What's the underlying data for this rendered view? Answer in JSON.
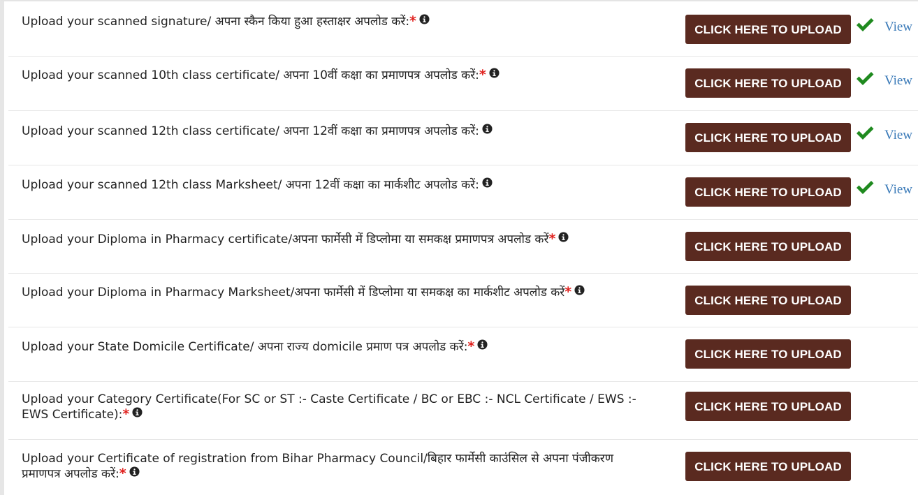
{
  "upload_rows": [
    {
      "label": "Upload your scanned signature/ अपना स्कैन किया हुआ हस्ताक्षर अपलोड करें:",
      "required": "*",
      "button": "CLICK HERE TO UPLOAD",
      "uploaded": true,
      "view_label": "View"
    },
    {
      "label": "Upload your scanned 10th class certificate/ अपना 10वीं कक्षा का प्रमाणपत्र अपलोड करें:",
      "required": "*",
      "button": "CLICK HERE TO UPLOAD",
      "uploaded": true,
      "view_label": "View"
    },
    {
      "label": "Upload your scanned 12th class certificate/ अपना 12वीं कक्षा का प्रमाणपत्र अपलोड करें:",
      "required": "",
      "button": "CLICK HERE TO UPLOAD",
      "uploaded": true,
      "view_label": "View"
    },
    {
      "label": "Upload your scanned 12th class Marksheet/ अपना 12वीं कक्षा का मार्कशीट अपलोड करें:",
      "required": "",
      "button": "CLICK HERE TO UPLOAD",
      "uploaded": true,
      "view_label": "View"
    },
    {
      "label": "Upload your Diploma in Pharmacy certificate/अपना फार्मेसी में डिप्लोमा या समकक्ष प्रमाणपत्र अपलोड करें",
      "required": "*",
      "button": "CLICK HERE TO UPLOAD",
      "uploaded": false
    },
    {
      "label": "Upload your Diploma in Pharmacy Marksheet/अपना फार्मेसी में डिप्लोमा या समकक्ष का मार्कशीट अपलोड करें",
      "required": "*",
      "button": "CLICK HERE TO UPLOAD",
      "uploaded": false
    },
    {
      "label": "Upload your State Domicile Certificate/ अपना राज्य domicile प्रमाण पत्र अपलोड करें:",
      "required": "*",
      "button": "CLICK HERE TO UPLOAD",
      "uploaded": false
    },
    {
      "label": "Upload your Category Certificate(For SC or ST :- Caste Certificate / BC or EBC :- NCL Certificate / EWS :- EWS Certificate):",
      "required": "*",
      "button": "CLICK HERE TO UPLOAD",
      "uploaded": false
    },
    {
      "label": "Upload your Certificate of registration from Bihar Pharmacy Council/बिहार फार्मेसी काउंसिल से अपना पंजीकरण प्रमाणपत्र अपलोड करें:",
      "required": "*",
      "button": "CLICK HERE TO UPLOAD",
      "uploaded": false
    }
  ],
  "icons": {
    "info": "info-circle-icon",
    "check": "checkmark-icon"
  },
  "colors": {
    "button_bg": "#5a2a20",
    "button_text": "#ffffff",
    "required": "#e0201d",
    "check": "#1f8a1f",
    "link": "#3a7ab8",
    "text": "#222222"
  }
}
